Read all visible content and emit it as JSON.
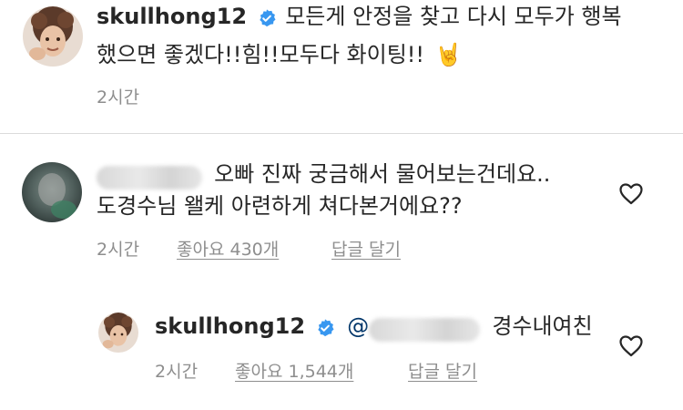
{
  "post": {
    "username": "skullhong12",
    "verified": true,
    "caption_line1": "모든게 안정을 찾고 다시 모두가 행복",
    "caption_line2": "했으면 좋겠다!!힘!!모두다 화이팅!!",
    "caption_emoji": "🤘",
    "time": "2시간"
  },
  "comment": {
    "username_hidden": true,
    "text_line1": "오빠 진짜 궁금해서 물어보는건데요..",
    "text_line2": "도경수님 왤케 아련하게 쳐다본거에요??",
    "time": "2시간",
    "likes": "좋아요 430개",
    "reply_label": "답글 달기",
    "like_icon": "heart-outline-icon"
  },
  "reply": {
    "username": "skullhong12",
    "verified": true,
    "mention_prefix": "@",
    "text": "경수내여친",
    "time": "2시간",
    "likes": "좋아요 1,544개",
    "reply_label": "답글 달기",
    "like_icon": "heart-outline-icon"
  },
  "colors": {
    "text": "#262626",
    "meta": "#8e8e8e",
    "verified_blue": "#3897f0",
    "divider": "#dbdbdb"
  }
}
